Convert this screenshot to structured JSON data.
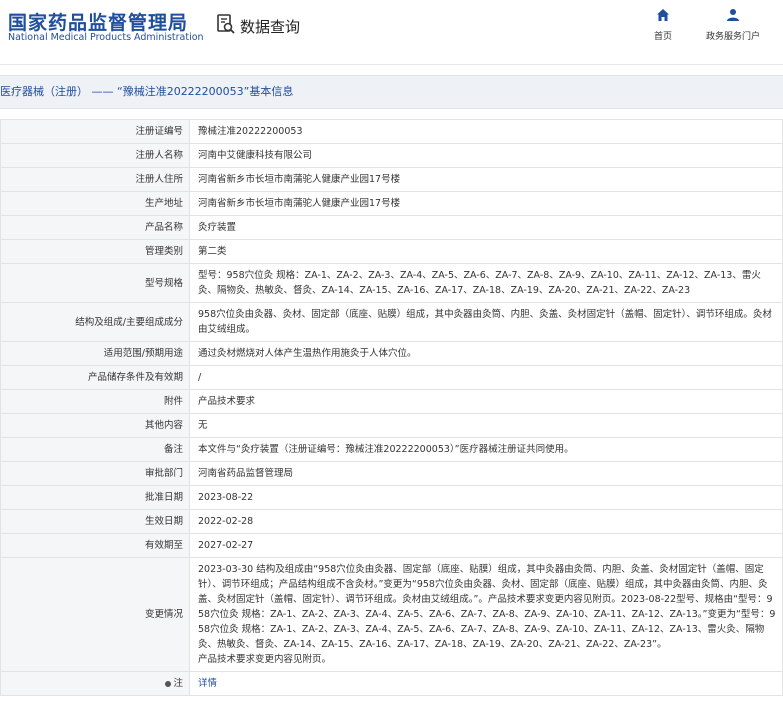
{
  "header": {
    "logo_cn": "国家药品监督管理局",
    "logo_en": "National Medical Products Administration",
    "data_query_label": "数据查询",
    "nav": [
      {
        "label": "首页",
        "icon": "home-icon"
      },
      {
        "label": "政务服务门户",
        "icon": "user-icon"
      }
    ]
  },
  "title": "医疗器械（注册） —— “豫械注准20222200053”基本信息",
  "rows": [
    {
      "key": "注册证编号",
      "value": "豫械注准20222200053"
    },
    {
      "key": "注册人名称",
      "value": "河南中艾健康科技有限公司"
    },
    {
      "key": "注册人住所",
      "value": "河南省新乡市长垣市南蒲驼人健康产业园17号楼"
    },
    {
      "key": "生产地址",
      "value": "河南省新乡市长垣市南蒲驼人健康产业园17号楼"
    },
    {
      "key": "产品名称",
      "value": "灸疗装置"
    },
    {
      "key": "管理类别",
      "value": "第二类"
    },
    {
      "key": "型号规格",
      "value": "型号：958穴位灸 规格：ZA-1、ZA-2、ZA-3、ZA-4、ZA-5、ZA-6、ZA-7、ZA-8、ZA-9、ZA-10、ZA-11、ZA-12、ZA-13、雷火灸、隔物灸、热敏灸、督灸、ZA-14、ZA-15、ZA-16、ZA-17、ZA-18、ZA-19、ZA-20、ZA-21、ZA-22、ZA-23"
    },
    {
      "key": "结构及组成/主要组成成分",
      "value": "958穴位灸由灸器、灸材、固定部（底座、贴膜）组成，其中灸器由灸筒、内胆、灸盖、灸材固定针（盖帽、固定针）、调节环组成。灸材由艾绒组成。"
    },
    {
      "key": "适用范围/预期用途",
      "value": "通过灸材燃烧对人体产生温热作用施灸于人体穴位。"
    },
    {
      "key": "产品储存条件及有效期",
      "value": "/"
    },
    {
      "key": "附件",
      "value": "产品技术要求"
    },
    {
      "key": "其他内容",
      "value": "无"
    },
    {
      "key": "备注",
      "value": "本文件与“灸疗装置（注册证编号：豫械注准20222200053）”医疗器械注册证共同使用。"
    },
    {
      "key": "审批部门",
      "value": "河南省药品监督管理局"
    },
    {
      "key": "批准日期",
      "value": "2023-08-22"
    },
    {
      "key": "生效日期",
      "value": "2022-02-28"
    },
    {
      "key": "有效期至",
      "value": "2027-02-27"
    },
    {
      "key": "变更情况",
      "value": "2023-03-30 结构及组成由“958穴位灸由灸器、固定部（底座、贴膜）组成，其中灸器由灸筒、内胆、灸盖、灸材固定针（盖帽、固定针）、调节环组成；产品结构组成不含灸材。”变更为“958穴位灸由灸器、灸材、固定部（底座、贴膜）组成，其中灸器由灸筒、内胆、灸盖、灸材固定针（盖帽、固定针）、调节环组成。灸材由艾绒组成。”。产品技术要求变更内容见附页。2023-08-22型号、规格由“型号：958穴位灸 规格：ZA-1、ZA-2、ZA-3、ZA-4、ZA-5、ZA-6、ZA-7、ZA-8、ZA-9、ZA-10、ZA-11、ZA-12、ZA-13。”变更为“型号：958穴位灸 规格：ZA-1、ZA-2、ZA-3、ZA-4、ZA-5、ZA-6、ZA-7、ZA-8、ZA-9、ZA-10、ZA-11、ZA-12、ZA-13、雷火灸、隔物灸、热敏灸、督灸、ZA-14、ZA-15、ZA-16、ZA-17、ZA-18、ZA-19、ZA-20、ZA-21、ZA-22、ZA-23”。\n产品技术要求变更内容见附页。"
    }
  ],
  "note": {
    "key": "注",
    "link": "详情"
  }
}
